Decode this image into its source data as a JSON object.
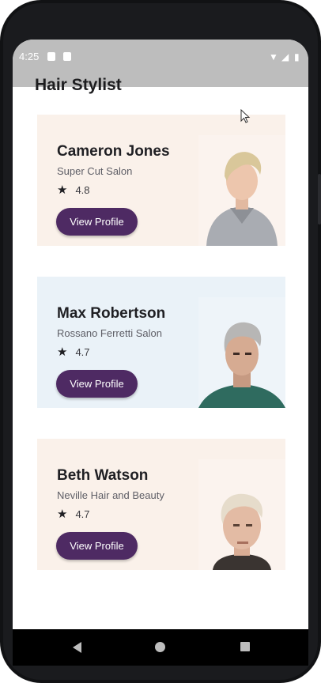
{
  "status_bar": {
    "time": "4:25"
  },
  "page_title": "Hair Stylist",
  "accent_color": "#4e2a63",
  "stylists": [
    {
      "name": "Cameron Jones",
      "salon": "Super Cut Salon",
      "rating": "4.8",
      "button_label": "View Profile",
      "card_color": "#faf1ea"
    },
    {
      "name": "Max Robertson",
      "salon": "Rossano Ferretti Salon",
      "rating": "4.7",
      "button_label": "View Profile",
      "card_color": "#eaf2f8"
    },
    {
      "name": "Beth Watson",
      "salon": "Neville Hair and Beauty",
      "rating": "4.7",
      "button_label": "View Profile",
      "card_color": "#faf1ea"
    }
  ],
  "icons": {
    "rating": "star-icon",
    "nav": [
      "back-icon",
      "home-icon",
      "recents-icon"
    ]
  }
}
